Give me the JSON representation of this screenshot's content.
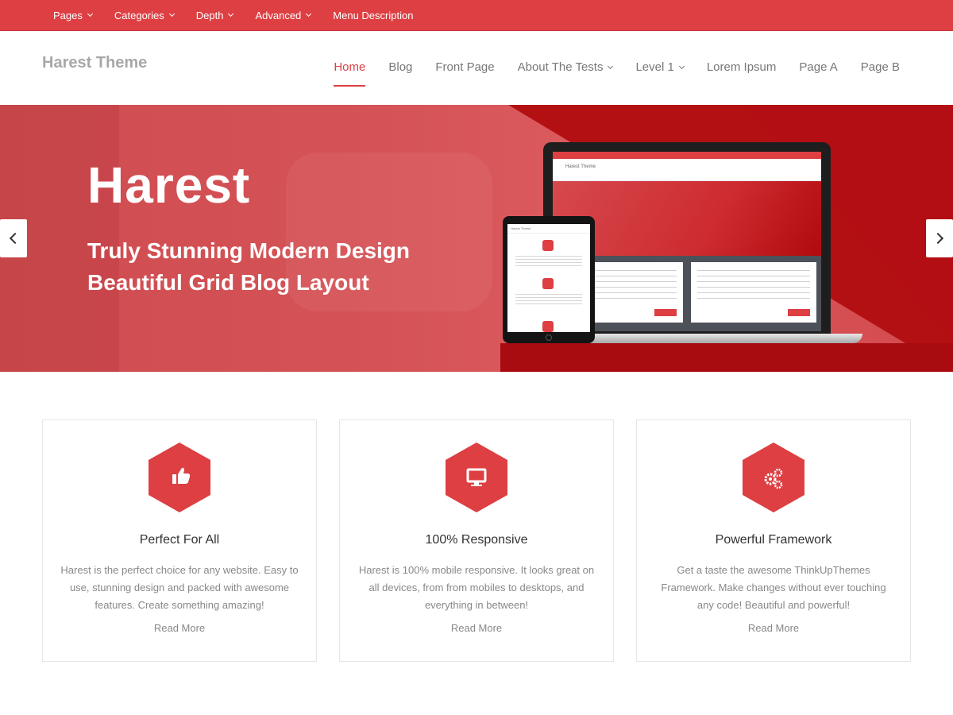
{
  "topbar": {
    "items": [
      {
        "label": "Pages",
        "has_dropdown": true
      },
      {
        "label": "Categories",
        "has_dropdown": true
      },
      {
        "label": "Depth",
        "has_dropdown": true
      },
      {
        "label": "Advanced",
        "has_dropdown": true
      },
      {
        "label": "Menu Description",
        "has_dropdown": false
      }
    ]
  },
  "header": {
    "logo": "Harest Theme",
    "nav": [
      {
        "label": "Home",
        "active": true
      },
      {
        "label": "Blog"
      },
      {
        "label": "Front Page"
      },
      {
        "label": "About The Tests",
        "has_dropdown": true
      },
      {
        "label": "Level 1",
        "has_dropdown": true
      },
      {
        "label": "Lorem Ipsum"
      },
      {
        "label": "Page A"
      },
      {
        "label": "Page B"
      }
    ]
  },
  "slider": {
    "title": "Harest",
    "subtitle_line1": "Truly Stunning Modern Design",
    "subtitle_line2": "Beautiful Grid Blog Layout",
    "mockup": {
      "laptop_logo": "Harest Theme",
      "tablet_logo": "Harest Theme"
    }
  },
  "features": [
    {
      "icon": "thumbs-up-icon",
      "title": "Perfect For All",
      "text": "Harest is the perfect choice for any website. Easy to use, stunning design and packed with awesome features. Create something amazing!",
      "link": "Read More"
    },
    {
      "icon": "desktop-icon",
      "title": "100% Responsive",
      "text": "Harest is 100% mobile responsive. It looks great on all devices, from from mobiles to desktops, and everything in between!",
      "link": "Read More"
    },
    {
      "icon": "gears-icon",
      "title": "Powerful Framework",
      "text": "Get a taste the awesome ThinkUpThemes Framework. Make changes without ever touching any code! Beautiful and powerful!",
      "link": "Read More"
    }
  ],
  "colors": {
    "accent": "#dd3f43",
    "dark_accent": "#b31014",
    "text": "#333333",
    "muted": "#888888"
  }
}
